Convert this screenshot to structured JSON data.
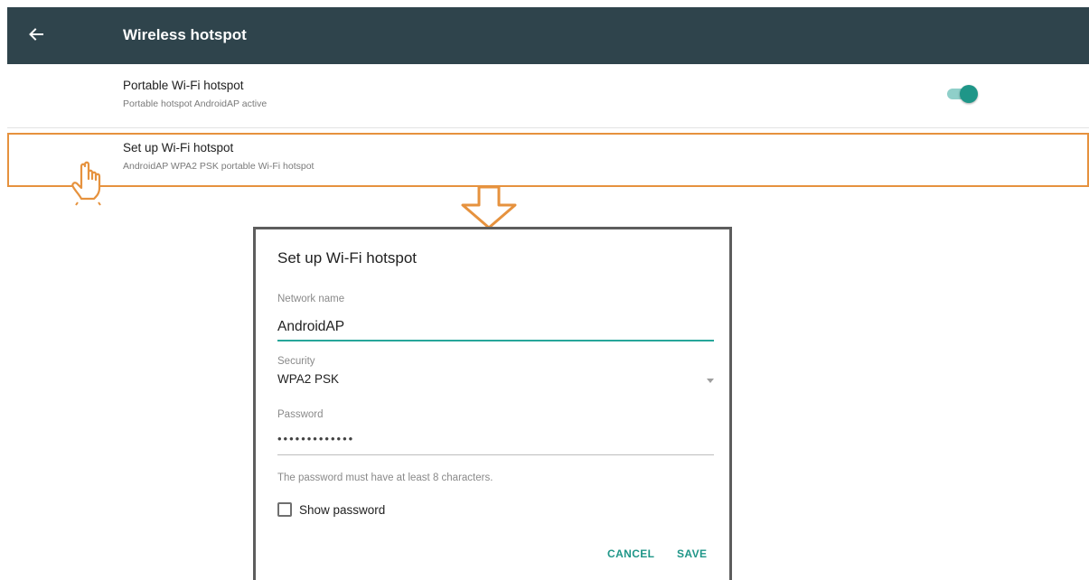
{
  "appbar": {
    "title": "Wireless hotspot",
    "back_icon": "arrow-left-icon"
  },
  "portable": {
    "title": "Portable Wi-Fi hotspot",
    "subtitle": "Portable hotspot AndroidAP active",
    "toggle_on": true
  },
  "setup": {
    "title": "Set up Wi-Fi hotspot",
    "subtitle": "AndroidAP WPA2 PSK portable Wi-Fi hotspot"
  },
  "dialog": {
    "title": "Set up Wi-Fi hotspot",
    "network_label": "Network name",
    "network_value": "AndroidAP",
    "security_label": "Security",
    "security_value": "WPA2 PSK",
    "password_label": "Password",
    "password_value": "•••••••••••••",
    "hint": "The password must have at least 8 characters.",
    "show_password_label": "Show password",
    "show_password_checked": false,
    "cancel_label": "CANCEL",
    "save_label": "SAVE"
  },
  "colors": {
    "appbar": "#2f444c",
    "accent": "#1f9688",
    "highlight": "#e6923e"
  }
}
